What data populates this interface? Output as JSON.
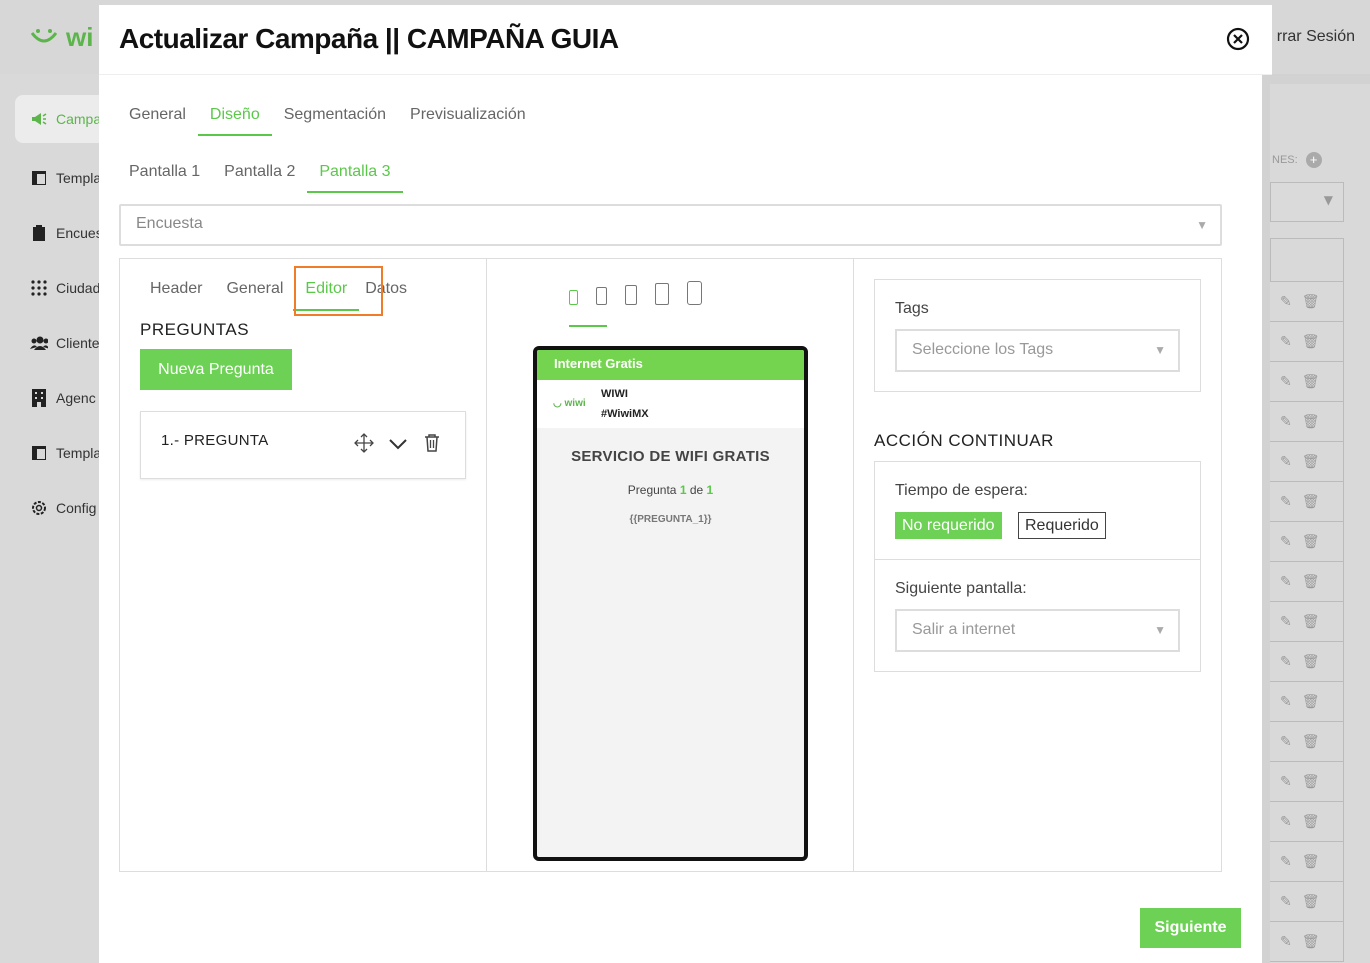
{
  "background": {
    "logo_text": "wi",
    "logout": "rrar Sesión",
    "sidebar": [
      {
        "label": "Campa",
        "icon": "megaphone-icon"
      },
      {
        "label": "Templa",
        "icon": "template-icon"
      },
      {
        "label": "Encues",
        "icon": "clipboard-icon"
      },
      {
        "label": "Ciudad",
        "icon": "dots-grid-icon"
      },
      {
        "label": "Cliente",
        "icon": "users-icon"
      },
      {
        "label": "Agenc",
        "icon": "building-icon"
      },
      {
        "label": "Templa",
        "icon": "template-icon"
      },
      {
        "label": "Config",
        "icon": "gear-icon"
      }
    ],
    "right_label": "NES:"
  },
  "modal": {
    "title": "Actualizar Campaña || CAMPAÑA GUIA",
    "main_tabs": [
      "General",
      "Diseño",
      "Segmentación",
      "Previsualización"
    ],
    "screen_tabs": [
      "Pantalla 1",
      "Pantalla 2",
      "Pantalla 3"
    ],
    "type_select": "Encuesta",
    "editor_tabs": [
      "Header",
      "General",
      "Editor",
      "Datos"
    ],
    "preguntas_label": "PREGUNTAS",
    "new_question_button": "Nueva Pregunta",
    "question_item": "1.- PREGUNTA",
    "preview": {
      "bar_text": "Internet Gratis",
      "logo_text": "wiwi",
      "brand_name": "WIWI",
      "brand_tag": "#WiwiMX",
      "title": "SERVICIO DE WIFI GRATIS",
      "count_prefix": "Pregunta",
      "count_current": "1",
      "count_of": "de",
      "count_total": "1",
      "variable": "{{PREGUNTA_1}}"
    },
    "tags_label": "Tags",
    "tags_placeholder": "Seleccione los Tags",
    "accion_label": "ACCIÓN CONTINUAR",
    "wait_label": "Tiempo de espera:",
    "wait_options": [
      "No requerido",
      "Requerido"
    ],
    "next_screen_label": "Siguiente pantalla:",
    "next_screen_value": "Salir a internet",
    "next_button": "Siguiente"
  },
  "colors": {
    "accent": "#5bc84a",
    "button": "#6cd154",
    "highlight": "#f07c2a"
  }
}
